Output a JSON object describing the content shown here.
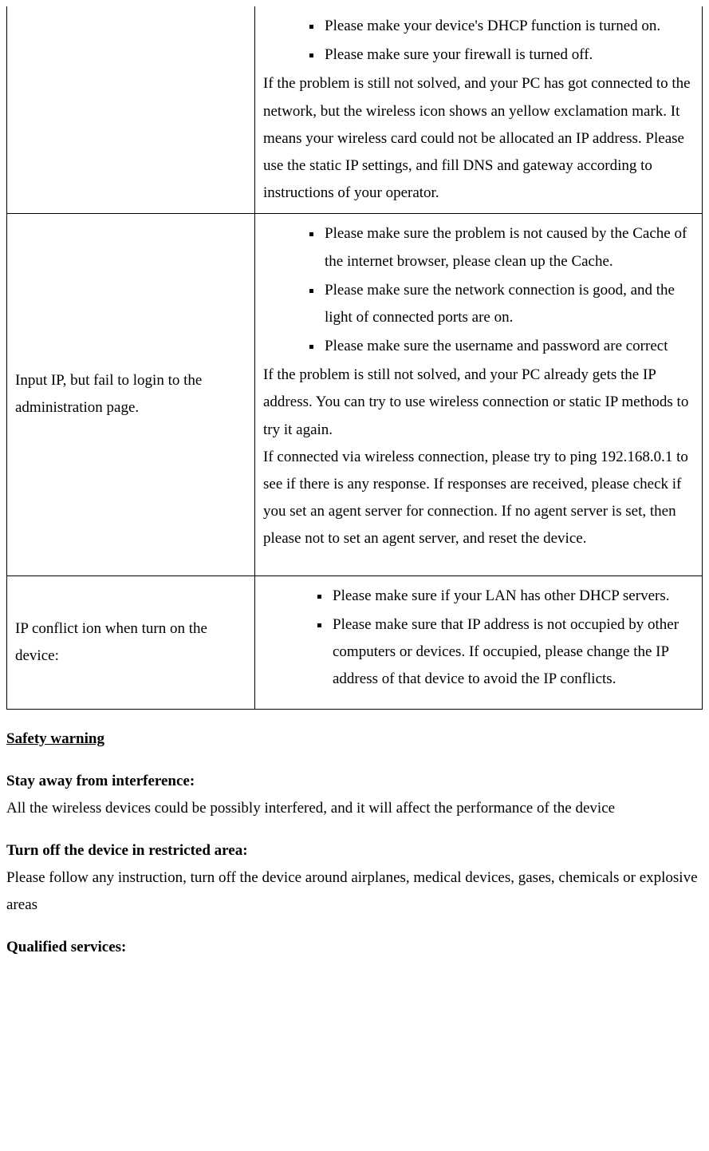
{
  "table": {
    "rows": [
      {
        "left": "",
        "bullets": [
          "Please make your device's DHCP function is turned on.",
          "Please make sure your firewall is turned off."
        ],
        "para": "If the problem is still not solved, and your PC has got connected to the network, but the wireless icon shows an yellow exclamation mark. It means your wireless card could not be allocated an IP address. Please use the static IP settings, and fill DNS and gateway according to instructions of your operator."
      },
      {
        "left": "Input IP, but fail to login to the administration page.",
        "bullets": [
          "Please make sure the problem is not caused by the Cache of the internet browser, please clean up the Cache.",
          "Please make sure the network connection is good, and the light of connected ports are on.",
          "Please make sure the username and password are correct"
        ],
        "para1": "If the problem is still not solved, and your PC already gets the IP address. You can try to use wireless connection or static IP methods to try it again.",
        "para2": "If connected via wireless connection, please try to ping 192.168.0.1 to see if there is any response. If responses are received, please check if you set an agent server for connection. If no agent server is set, then please not to set an agent server, and reset the device."
      },
      {
        "left": "IP conflict ion when turn on the device:",
        "bullets": [
          "Please make sure if your LAN has other DHCP servers.",
          "Please make sure that IP address is not occupied by other computers or devices. If occupied, please change the IP address of that device to avoid the IP conflicts."
        ]
      }
    ]
  },
  "safety": {
    "heading": "Safety warning",
    "sections": [
      {
        "title": "Stay away from interference:",
        "text": "All the wireless devices could be possibly interfered, and it will affect the performance of the device"
      },
      {
        "title": "Turn off the device in restricted area:",
        "text": "Please follow any instruction, turn off the device around airplanes, medical devices, gases, chemicals or explosive areas"
      },
      {
        "title": "Qualified services:",
        "text": ""
      }
    ]
  }
}
